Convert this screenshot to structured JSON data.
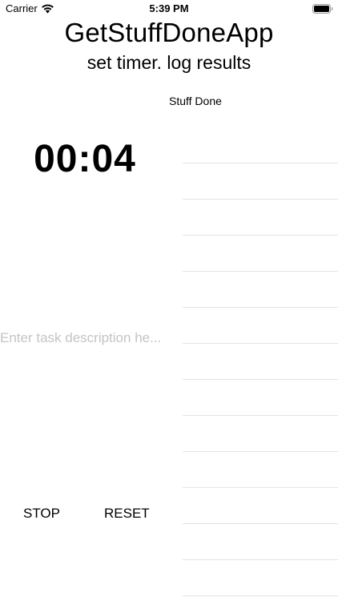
{
  "status_bar": {
    "carrier": "Carrier",
    "time": "5:39 PM",
    "wifi_icon": "wifi-icon",
    "battery_icon": "battery-icon"
  },
  "app": {
    "title": "GetStuffDoneApp",
    "subtitle": "set timer. log results"
  },
  "timer": {
    "display": "00:04"
  },
  "task_input": {
    "value": "",
    "placeholder": "Enter task description he..."
  },
  "controls": {
    "stop_label": "STOP",
    "reset_label": "RESET"
  },
  "stuff_done": {
    "header": "Stuff Done",
    "items": [
      "",
      "",
      "",
      "",
      "",
      "",
      "",
      "",
      "",
      "",
      "",
      "",
      ""
    ]
  },
  "colors": {
    "text": "#000000",
    "placeholder": "#c4c4c6",
    "separator": "#e3e3e6",
    "background": "#ffffff"
  }
}
